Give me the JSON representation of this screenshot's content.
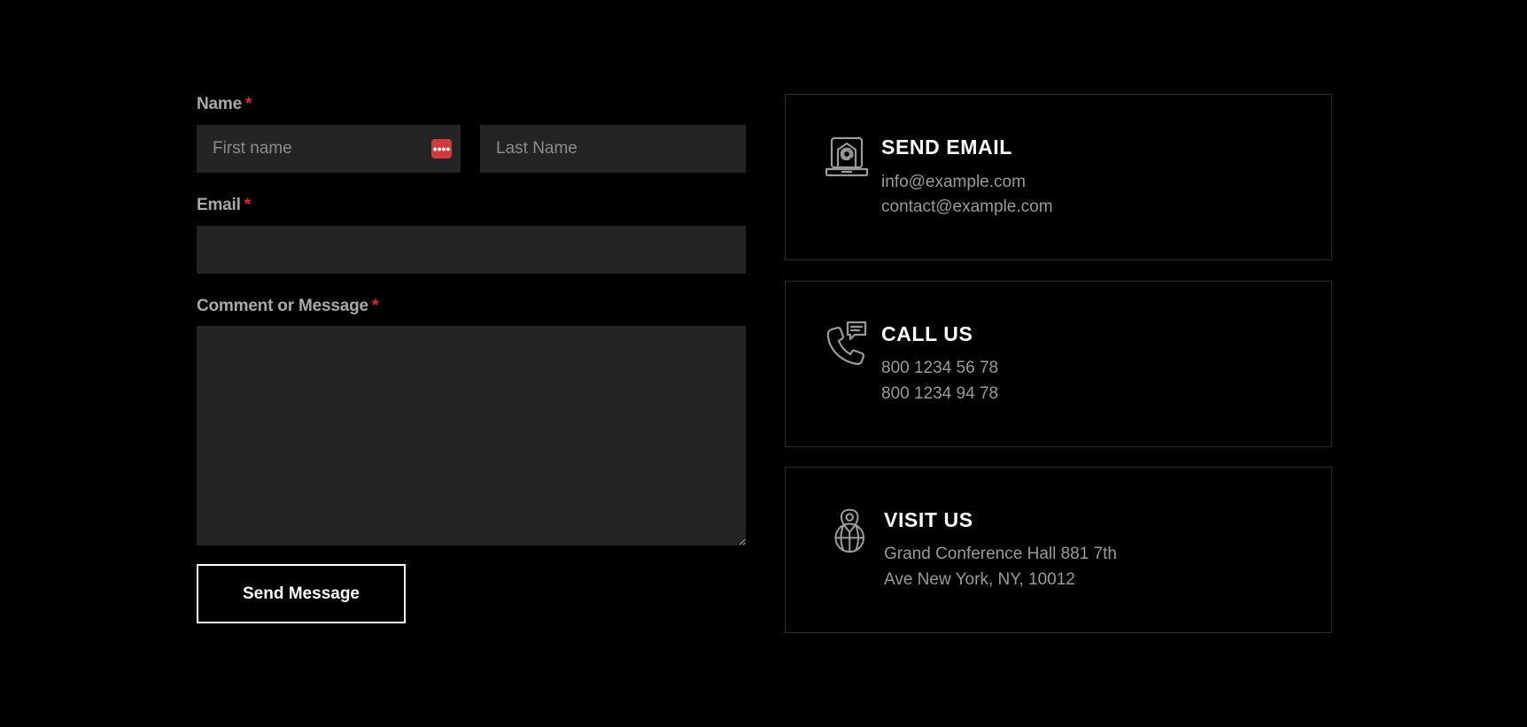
{
  "form": {
    "name_label": "Name",
    "required_mark": "*",
    "first_name": {
      "placeholder": "First name",
      "value": ""
    },
    "password_badge_glyph": "••••",
    "last_name": {
      "placeholder": "Last Name",
      "value": ""
    },
    "email_label": "Email",
    "email": {
      "value": ""
    },
    "message_label": "Comment or Message",
    "message": {
      "value": ""
    },
    "submit_label": "Send Message"
  },
  "cards": [
    {
      "icon": "laptop-email-icon",
      "title": "SEND EMAIL",
      "lines": [
        "info@example.com",
        "contact@example.com"
      ]
    },
    {
      "icon": "phone-chat-icon",
      "title": "CALL US",
      "lines": [
        "800 1234 56 78",
        "800 1234 94 78"
      ]
    },
    {
      "icon": "location-globe-icon",
      "title": "VISIT US",
      "lines": [
        "Grand Conference Hall 881 7th",
        "Ave New York, NY, 10012"
      ]
    }
  ],
  "colors": {
    "background": "#000000",
    "field": "#242424",
    "required": "#e3262e",
    "password_badge": "#d23a3d",
    "card_border": "#2b2b2b"
  }
}
